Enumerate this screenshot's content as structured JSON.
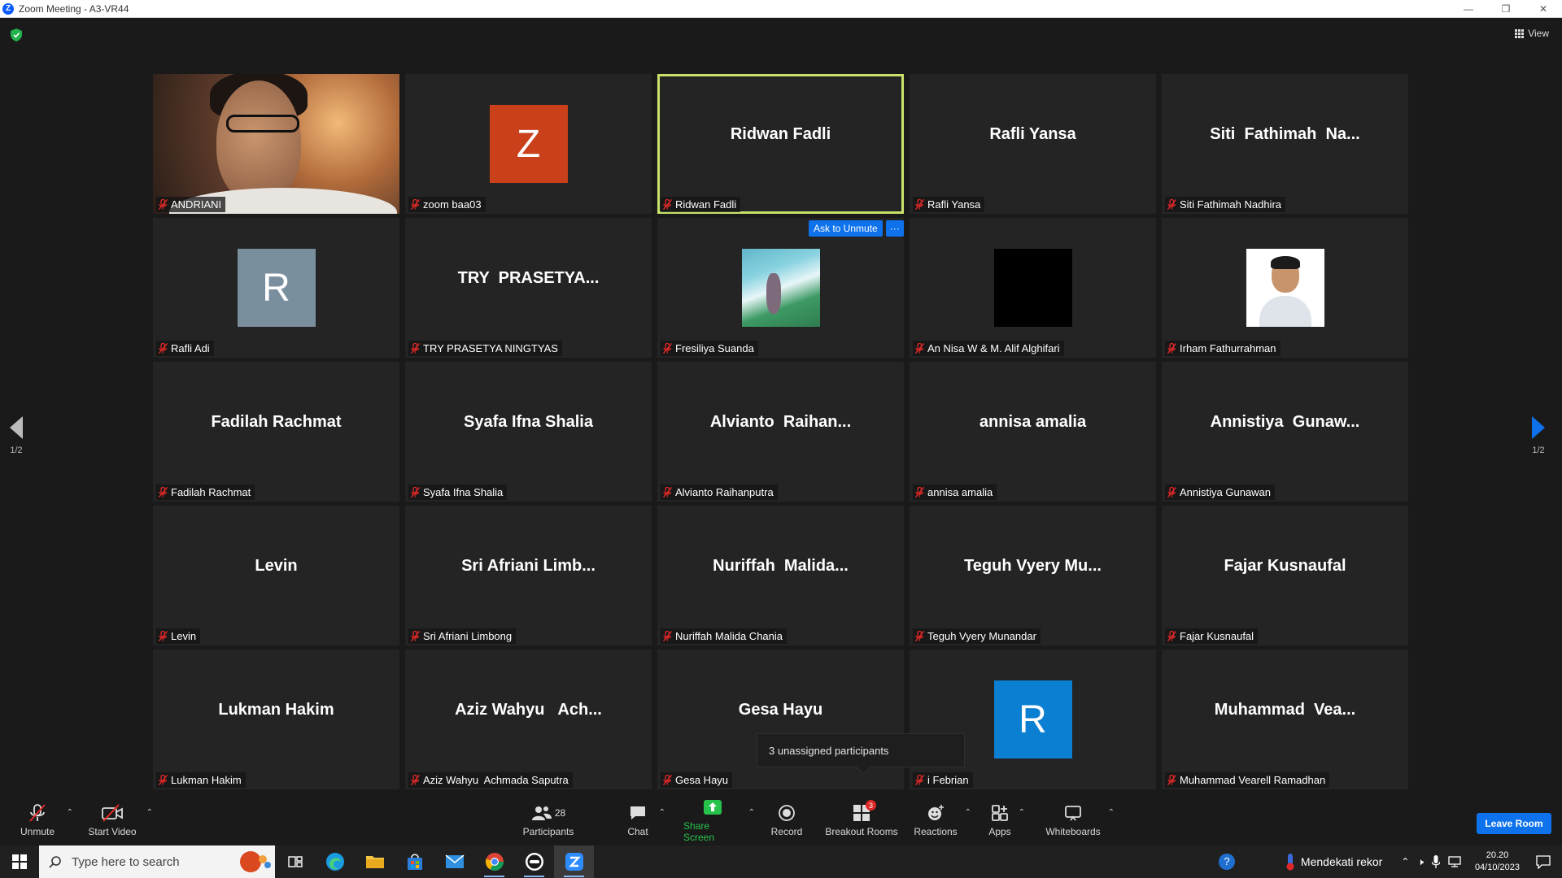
{
  "window": {
    "title": "Zoom Meeting - A3-VR44"
  },
  "header": {
    "view_label": "View"
  },
  "tiles": [
    {
      "big": "",
      "label": "ANDRIANI",
      "kind": "photo"
    },
    {
      "big": "",
      "label": "zoom baa03",
      "kind": "letter",
      "letter": "Z",
      "color": "#c9401b"
    },
    {
      "big": "Ridwan Fadli",
      "label": "Ridwan Fadli",
      "kind": "name",
      "active": true
    },
    {
      "big": "Rafli Yansa",
      "label": "Rafli Yansa",
      "kind": "name"
    },
    {
      "big": "Siti  Fathimah  Na...",
      "label": "Siti Fathimah Nadhira",
      "kind": "name"
    },
    {
      "big": "",
      "label": "Rafli Adi",
      "kind": "letter",
      "letter": "R",
      "color": "#7a8f9e"
    },
    {
      "big": "TRY  PRASETYA...",
      "label": "TRY PRASETYA NINGTYAS",
      "kind": "name"
    },
    {
      "big": "",
      "label": "Fresiliya Suanda",
      "kind": "waterfall"
    },
    {
      "big": "",
      "label": "An Nisa W & M. Alif Alghifari",
      "kind": "black"
    },
    {
      "big": "",
      "label": "Irham Fathurrahman",
      "kind": "portrait"
    },
    {
      "big": "Fadilah Rachmat",
      "label": "Fadilah Rachmat",
      "kind": "name"
    },
    {
      "big": "Syafa Ifna Shalia",
      "label": "Syafa Ifna Shalia",
      "kind": "name"
    },
    {
      "big": "Alvianto  Raihan...",
      "label": "Alvianto Raihanputra",
      "kind": "name"
    },
    {
      "big": "annisa amalia",
      "label": "annisa amalia",
      "kind": "name"
    },
    {
      "big": "Annistiya  Gunaw...",
      "label": "Annistiya Gunawan",
      "kind": "name"
    },
    {
      "big": "Levin",
      "label": "Levin",
      "kind": "name"
    },
    {
      "big": "Sri Afriani Limb...",
      "label": "Sri Afriani Limbong",
      "kind": "name"
    },
    {
      "big": "Nuriffah  Malida...",
      "label": "Nuriffah Malida Chania",
      "kind": "name"
    },
    {
      "big": "Teguh Vyery Mu...",
      "label": "Teguh Vyery Munandar",
      "kind": "name"
    },
    {
      "big": "Fajar Kusnaufal",
      "label": "Fajar Kusnaufal",
      "kind": "name"
    },
    {
      "big": "Lukman Hakim",
      "label": "Lukman Hakim",
      "kind": "name"
    },
    {
      "big": "Aziz Wahyu   Ach...",
      "label": "Aziz Wahyu  Achmada Saputra",
      "kind": "name"
    },
    {
      "big": "Gesa Hayu",
      "label": "Gesa Hayu",
      "kind": "name"
    },
    {
      "big": "",
      "label": "i Febrian",
      "kind": "letter",
      "letter": "R",
      "color": "#0b7fd1"
    },
    {
      "big": "Muhammad  Vea...",
      "label": "Muhammad Vearell Ramadhan",
      "kind": "name"
    }
  ],
  "ask_unmute": {
    "label": "Ask to Unmute",
    "more": "···"
  },
  "pager": {
    "left": "1/2",
    "right": "1/2"
  },
  "popover": {
    "text": "3 unassigned participants"
  },
  "toolbar": {
    "unmute": "Unmute",
    "start_video": "Start Video",
    "participants": "Participants",
    "participants_count": "28",
    "chat": "Chat",
    "share_screen": "Share Screen",
    "record": "Record",
    "breakout_rooms": "Breakout Rooms",
    "breakout_badge": "3",
    "reactions": "Reactions",
    "apps": "Apps",
    "whiteboards": "Whiteboards",
    "leave": "Leave Room"
  },
  "taskbar": {
    "search_placeholder": "Type here to search",
    "news": "Mendekati rekor",
    "time": "20.20",
    "date": "04/10/2023"
  }
}
